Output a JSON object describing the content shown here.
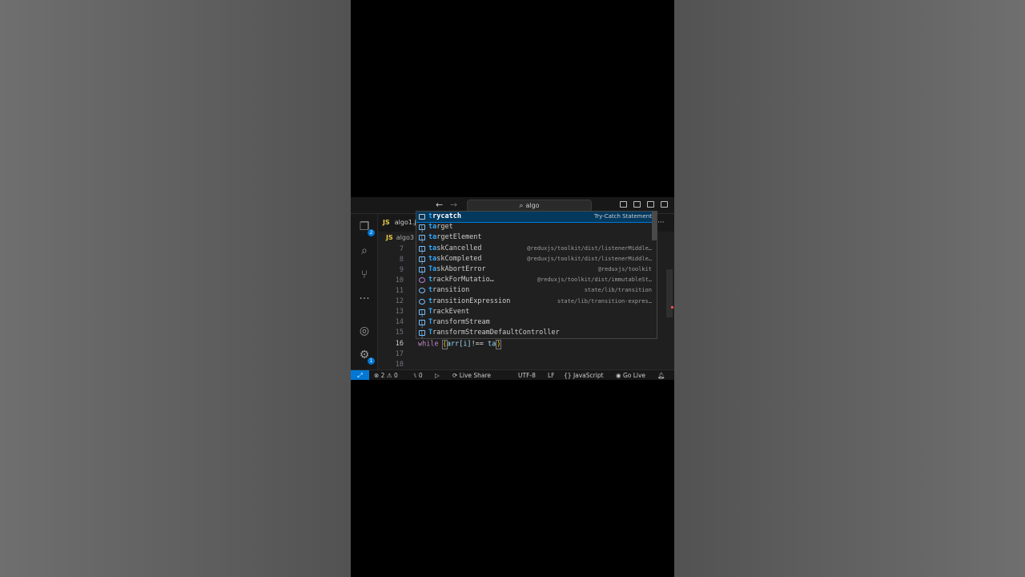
{
  "window": {
    "title": "algo",
    "nav_back": "←",
    "nav_forward": "→"
  },
  "activity_bar": {
    "explorer_badge": "2",
    "more": "···",
    "settings_badge": "1"
  },
  "tab": {
    "lang": "JS",
    "label": "algo1.j"
  },
  "breadcrumb": {
    "lang": "JS",
    "label": "algo3"
  },
  "more_actions": "···",
  "line_numbers": [
    "7",
    "8",
    "9",
    "10",
    "11",
    "12",
    "13",
    "14",
    "15",
    "16",
    "17",
    "18"
  ],
  "active_line": "16",
  "fold_marker": "⌵",
  "code": {
    "keyword": "while",
    "space": " ",
    "open_paren": "(",
    "expr": "arr[i]",
    "operator": "!== ",
    "partial": "ta",
    "close_paren": ")"
  },
  "suggestions": [
    {
      "label_hl": "t",
      "label_rest": "rycatch",
      "kind": "snippet",
      "detail": "Try-Catch Statement",
      "selected": true
    },
    {
      "label_hl": "ta",
      "label_rest": "rget",
      "kind": "variable",
      "detail": ""
    },
    {
      "label_hl": "ta",
      "label_rest": "rgetElement",
      "kind": "variable",
      "detail": ""
    },
    {
      "label_hl": "ta",
      "label_rest": "skCancelled",
      "kind": "variable",
      "detail": "@reduxjs/toolkit/dist/listenerMiddle…"
    },
    {
      "label_hl": "ta",
      "label_rest": "skCompleted",
      "kind": "variable",
      "detail": "@reduxjs/toolkit/dist/listenerMiddle…"
    },
    {
      "label_hl": "Ta",
      "label_rest": "skAbortError",
      "kind": "variable",
      "detail": "@reduxjs/toolkit"
    },
    {
      "label_hl": "t",
      "label_rest": "rackForMutatio…",
      "kind": "module",
      "detail": "@reduxjs/toolkit/dist/immutableSt…"
    },
    {
      "label_hl": "t",
      "label_rest": "ransition",
      "kind": "interface",
      "detail": "state/lib/transition"
    },
    {
      "label_hl": "t",
      "label_rest": "ransitionExpression",
      "kind": "interface",
      "detail": "state/lib/transition-expres…"
    },
    {
      "label_hl": "T",
      "label_rest": "rackEvent",
      "kind": "variable",
      "detail": ""
    },
    {
      "label_hl": "T",
      "label_rest": "ransformStream",
      "kind": "variable",
      "detail": ""
    },
    {
      "label_hl": "T",
      "label_rest": "ransformStreamDefaultController",
      "kind": "variable",
      "detail": ""
    }
  ],
  "statusbar": {
    "remote_icon": "⤢",
    "errors": "2",
    "warnings": "0",
    "ports": "0",
    "live_share": "Live Share",
    "encoding": "UTF-8",
    "eol": "LF",
    "braces": "{}",
    "language": "JavaScript",
    "go_live": "Go Live"
  },
  "colors": {
    "accent": "#0078d4",
    "match_highlight": "#2aaaff",
    "keyword": "#c586c0",
    "js_badge": "#e8c94b"
  }
}
